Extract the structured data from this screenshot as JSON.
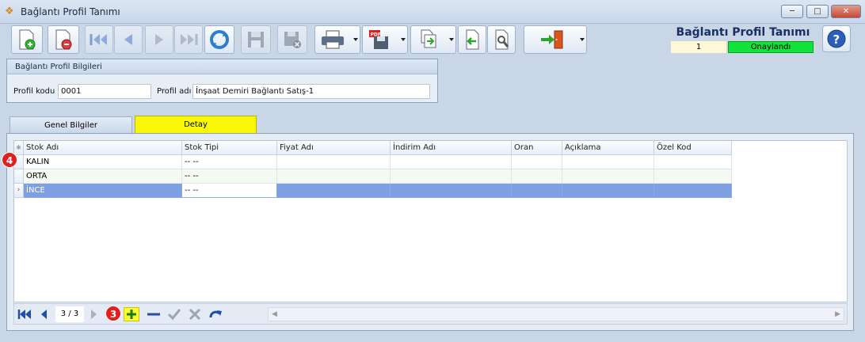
{
  "window": {
    "title": "Bağlantı Profil Tanımı"
  },
  "header": {
    "title": "Bağlantı Profil Tanımı",
    "record_no": "1",
    "status": "Onaylandı",
    "status_color": "#11e33a"
  },
  "form": {
    "group_title": "Bağlantı Profil Bilgileri",
    "code_label": "Profil kodu",
    "code_value": "0001",
    "name_label": "Profil adı",
    "name_value": "İnşaat Demiri Bağlantı Satış-1"
  },
  "tabs": [
    {
      "label": "Genel Bilgiler"
    },
    {
      "label": "Detay"
    }
  ],
  "grid": {
    "columns": [
      "Stok Adı",
      "Stok Tipi",
      "Fiyat Adı",
      "İndirim Adı",
      "Oran",
      "Açıklama",
      "Özel Kod"
    ],
    "rows": [
      [
        "KALIN",
        "-- --",
        "",
        "",
        "",
        "",
        ""
      ],
      [
        "ORTA",
        "-- --",
        "",
        "",
        "",
        "",
        ""
      ],
      [
        "İNCE",
        "-- --",
        "",
        "",
        "",
        "",
        ""
      ]
    ]
  },
  "navigator": {
    "page": "3 / 3"
  },
  "badges": {
    "grid": "4",
    "add": "3"
  },
  "icons": [
    "new-record-icon",
    "delete-record-icon",
    "first-record-icon",
    "prev-record-icon",
    "next-record-icon",
    "last-record-icon",
    "refresh-icon",
    "save-icon",
    "cancel-save-icon",
    "print-icon",
    "export-pdf-icon",
    "import-icon",
    "back-icon",
    "properties-icon",
    "exit-icon",
    "help-icon"
  ]
}
